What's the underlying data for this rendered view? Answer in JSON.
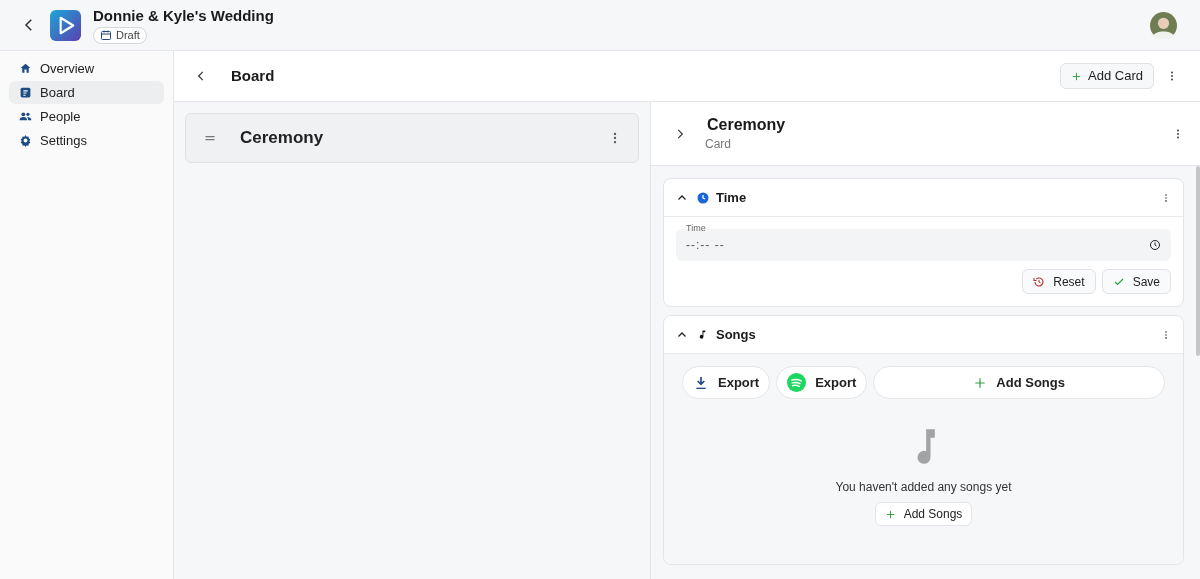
{
  "header": {
    "title": "Donnie & Kyle's Wedding",
    "status_badge": "Draft"
  },
  "sidebar": {
    "items": [
      {
        "label": "Overview",
        "kind": "home",
        "selected": false
      },
      {
        "label": "Board",
        "kind": "board",
        "selected": true
      },
      {
        "label": "People",
        "kind": "people",
        "selected": false
      },
      {
        "label": "Settings",
        "kind": "gear",
        "selected": false
      }
    ]
  },
  "board": {
    "title": "Board",
    "add_button": "Add Card",
    "cards": [
      {
        "title": "Ceremony"
      }
    ]
  },
  "detail": {
    "title": "Ceremony",
    "subtitle": "Card",
    "sections": [
      {
        "kind": "time",
        "title": "Time",
        "expanded": true,
        "field_label": "Time",
        "field_value": "--:-- --",
        "buttons": [
          {
            "kind": "reset",
            "label": "Reset"
          },
          {
            "kind": "save",
            "label": "Save"
          }
        ]
      },
      {
        "kind": "songs",
        "title": "Songs",
        "expanded": true,
        "actions": [
          {
            "kind": "download",
            "label": "Export"
          },
          {
            "kind": "spotify",
            "label": "Export"
          },
          {
            "kind": "add",
            "label": "Add Songs"
          }
        ],
        "empty_text": "You haven't added any songs yet",
        "empty_button": "Add Songs"
      }
    ]
  }
}
